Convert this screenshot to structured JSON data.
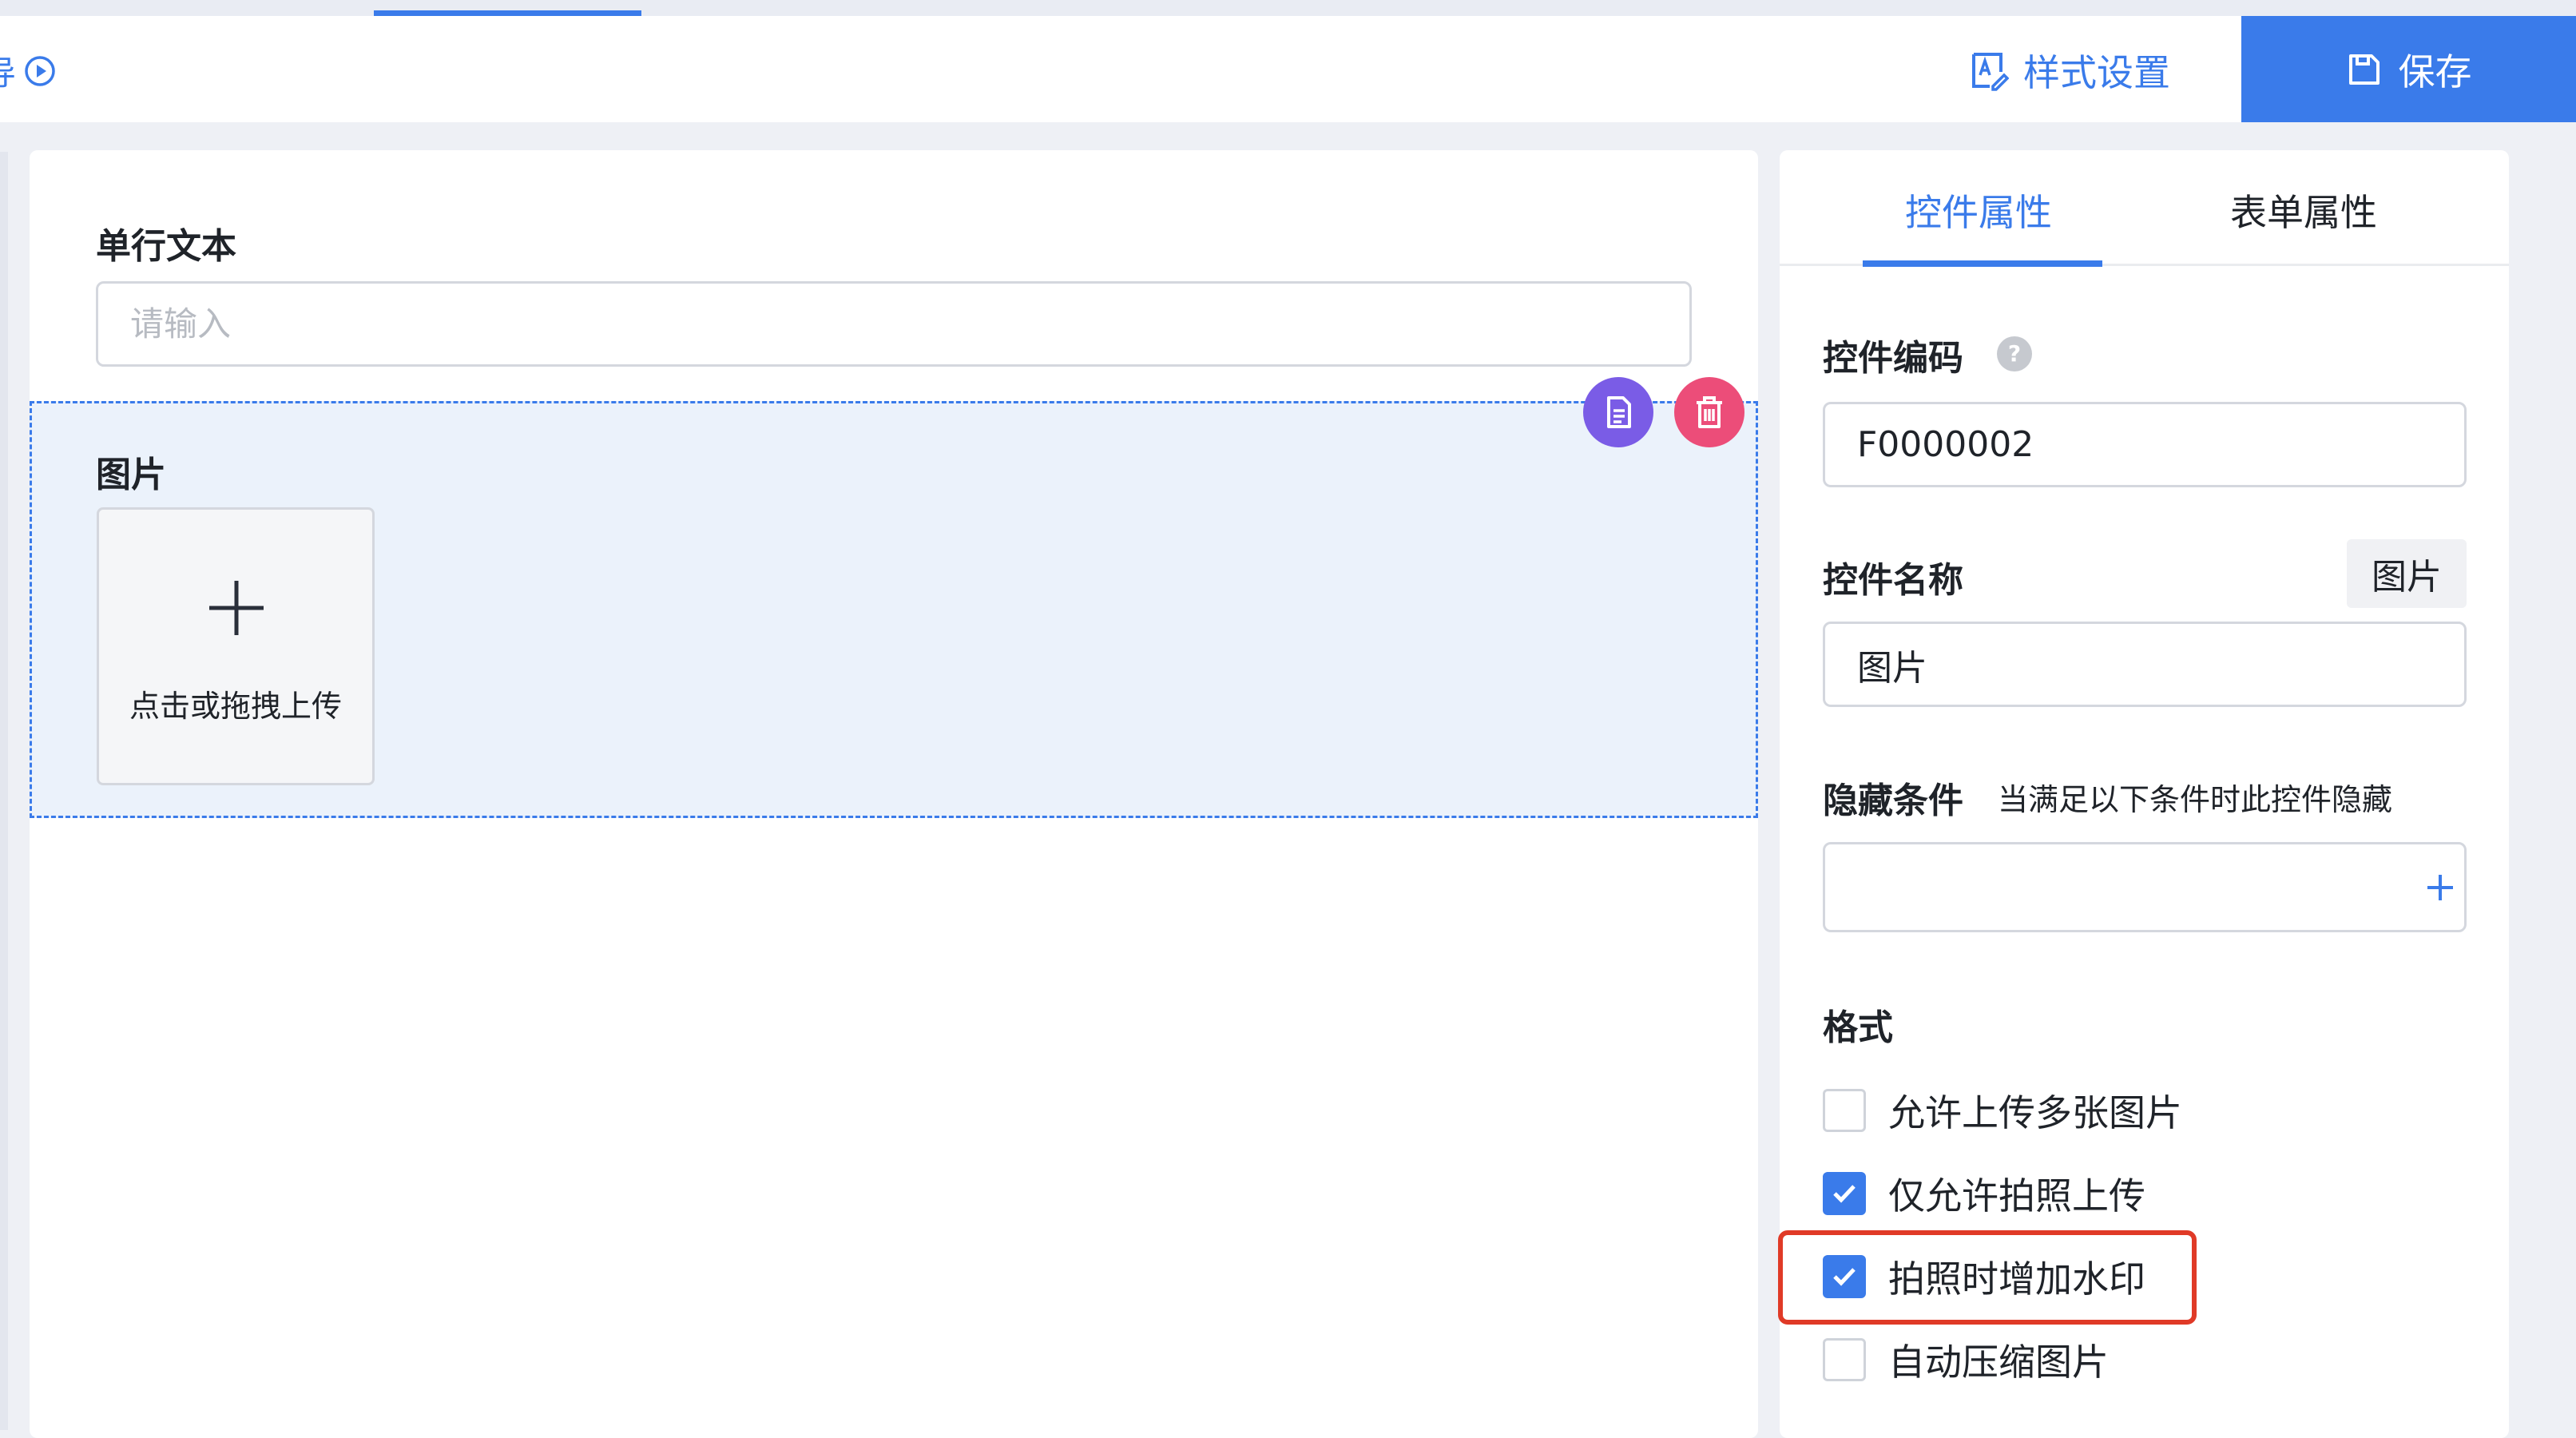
{
  "header": {
    "preview_text": "导",
    "style_settings_label": "样式设置",
    "save_label": "保存"
  },
  "canvas": {
    "text_field": {
      "label": "单行文本",
      "placeholder": "请输入"
    },
    "image_field": {
      "label": "图片",
      "upload_text": "点击或拖拽上传"
    }
  },
  "panel": {
    "tabs": {
      "control_props": "控件属性",
      "form_props": "表单属性"
    },
    "code": {
      "label": "控件编码",
      "value": "F0000002"
    },
    "name": {
      "label": "控件名称",
      "tag": "图片",
      "value": "图片"
    },
    "hide": {
      "label": "隐藏条件",
      "hint": "当满足以下条件时此控件隐藏"
    },
    "format": {
      "label": "格式",
      "options": [
        {
          "label": "允许上传多张图片",
          "checked": false
        },
        {
          "label": "仅允许拍照上传",
          "checked": true
        },
        {
          "label": "拍照时增加水印",
          "checked": true
        },
        {
          "label": "自动压缩图片",
          "checked": false
        }
      ]
    }
  },
  "colors": {
    "accent": "#3a7bea",
    "copy_button": "#7a5ce6",
    "delete_button": "#ec4d79",
    "highlight": "#e03a27"
  }
}
